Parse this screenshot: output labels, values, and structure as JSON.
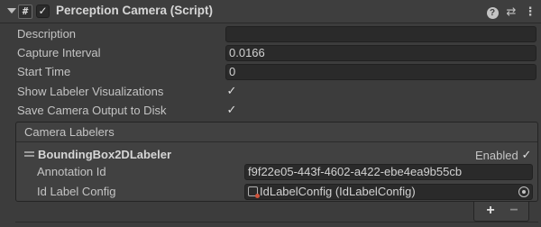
{
  "component": {
    "title": "Perception Camera (Script)",
    "script_icon": "#",
    "enabled_mark": "✓",
    "help_icon": "?",
    "presets_icon": "⇄",
    "menu_icon": "⋮"
  },
  "properties": {
    "description_label": "Description",
    "description_value": "",
    "capture_interval_label": "Capture Interval",
    "capture_interval_value": "0.0166",
    "start_time_label": "Start Time",
    "start_time_value": "0",
    "show_labeler_vis_label": "Show Labeler Visualizations",
    "show_labeler_vis_checked": true,
    "save_output_label": "Save Camera Output to Disk",
    "save_output_checked": true,
    "check_mark": "✓"
  },
  "labelers": {
    "header": "Camera Labelers",
    "items": [
      {
        "name": "BoundingBox2DLabeler",
        "enabled_label": "Enabled",
        "enabled": true,
        "annotation_id_label": "Annotation Id",
        "annotation_id_value": "f9f22e05-443f-4602-a422-ebe4ea9b55cb",
        "id_label_config_label": "Id Label Config",
        "id_label_config_value": "IdLabelConfig (IdLabelConfig)"
      }
    ],
    "add_button": "+",
    "remove_button": "−"
  }
}
